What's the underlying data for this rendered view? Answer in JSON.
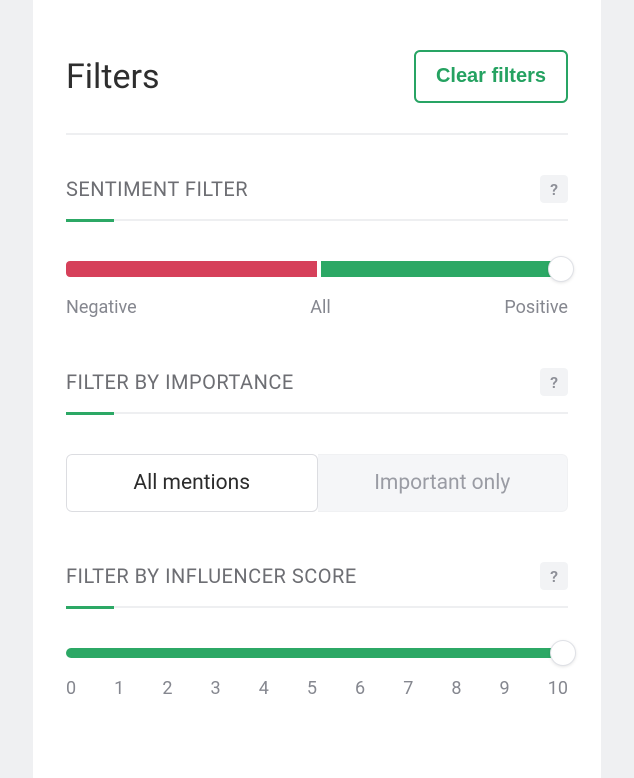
{
  "header": {
    "title": "Filters",
    "clear_button": "Clear filters"
  },
  "sentiment": {
    "title": "SENTIMENT FILTER",
    "help": "?",
    "labels": {
      "negative": "Negative",
      "all": "All",
      "positive": "Positive"
    },
    "colors": {
      "negative": "#d6405a",
      "positive": "#2ca865"
    }
  },
  "importance": {
    "title": "FILTER BY IMPORTANCE",
    "help": "?",
    "options": {
      "all": "All mentions",
      "important": "Important only"
    },
    "selected": "all"
  },
  "influencer": {
    "title": "FILTER BY INFLUENCER SCORE",
    "help": "?",
    "min": 0,
    "max": 10,
    "value": 10,
    "ticks": {
      "t0": "0",
      "t1": "1",
      "t2": "2",
      "t3": "3",
      "t4": "4",
      "t5": "5",
      "t6": "6",
      "t7": "7",
      "t8": "8",
      "t9": "9",
      "t10": "10"
    }
  }
}
